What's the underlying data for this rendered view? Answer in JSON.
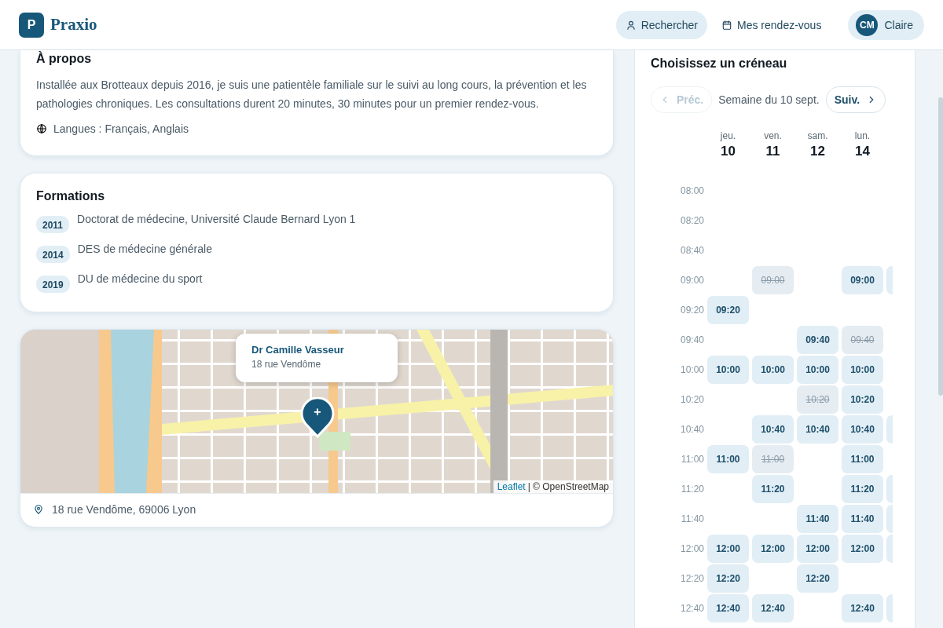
{
  "header": {
    "logo_letter": "P",
    "brand": "Praxio",
    "nav": [
      {
        "label": "Rechercher",
        "selected": true
      },
      {
        "label": "Mes rendez-vous",
        "selected": false
      }
    ],
    "user": {
      "initials": "CM",
      "name": "Claire"
    }
  },
  "about": {
    "title": "À propos",
    "text": "Installée aux Brotteaux depuis 2016, je suis une patientèle familiale sur le suivi au long cours, la prévention et les pathologies chroniques. Les consultations durent 20 minutes, 30 minutes pour un premier rendez-vous.",
    "languages": "Langues : Français, Anglais"
  },
  "education": {
    "title": "Formations",
    "items": [
      {
        "year": "2011",
        "label": "Doctorat de médecine, Université Claude Bernard Lyon 1"
      },
      {
        "year": "2014",
        "label": "DES de médecine générale"
      },
      {
        "year": "2019",
        "label": "DU de médecine du sport"
      }
    ]
  },
  "map": {
    "popup_title": "Dr Camille Vasseur",
    "popup_subtitle": "18 rue Vendôme",
    "marker_symbol": "+",
    "attribution_link": "Leaflet",
    "attribution_text": "| © OpenStreetMap",
    "address": "18 rue Vendôme, 69006 Lyon"
  },
  "calendar": {
    "title": "Choisissez un créneau",
    "prev": {
      "label": "Préc.",
      "disabled": true
    },
    "week_label": "Semaine du 10 sept.",
    "next": {
      "label": "Suiv.",
      "disabled": false
    },
    "days": [
      {
        "weekday": "jeu.",
        "day": "10"
      },
      {
        "weekday": "ven.",
        "day": "11"
      },
      {
        "weekday": "sam.",
        "day": "12"
      },
      {
        "weekday": "lun.",
        "day": "14"
      }
    ],
    "rows": [
      {
        "time": "08:00",
        "slots": [
          {
            "kind": "none"
          },
          {
            "kind": "none"
          },
          {
            "kind": "none"
          },
          {
            "kind": "none"
          }
        ]
      },
      {
        "time": "08:20",
        "slots": [
          {
            "kind": "none"
          },
          {
            "kind": "none"
          },
          {
            "kind": "none"
          },
          {
            "kind": "none"
          }
        ]
      },
      {
        "time": "08:40",
        "slots": [
          {
            "kind": "none"
          },
          {
            "kind": "none"
          },
          {
            "kind": "none"
          },
          {
            "kind": "none"
          }
        ]
      },
      {
        "time": "09:00",
        "edge_slot": true,
        "slots": [
          {
            "kind": "none"
          },
          {
            "kind": "taken",
            "label": "09:00"
          },
          {
            "kind": "none"
          },
          {
            "kind": "open",
            "label": "09:00"
          }
        ]
      },
      {
        "time": "09:20",
        "slots": [
          {
            "kind": "open",
            "label": "09:20"
          },
          {
            "kind": "none"
          },
          {
            "kind": "none"
          },
          {
            "kind": "none"
          }
        ]
      },
      {
        "time": "09:40",
        "slots": [
          {
            "kind": "none"
          },
          {
            "kind": "none"
          },
          {
            "kind": "open",
            "label": "09:40"
          },
          {
            "kind": "taken",
            "label": "09:40"
          }
        ]
      },
      {
        "time": "10:00",
        "slots": [
          {
            "kind": "open",
            "label": "10:00"
          },
          {
            "kind": "open",
            "label": "10:00"
          },
          {
            "kind": "open",
            "label": "10:00"
          },
          {
            "kind": "open",
            "label": "10:00"
          }
        ]
      },
      {
        "time": "10:20",
        "slots": [
          {
            "kind": "none"
          },
          {
            "kind": "none"
          },
          {
            "kind": "taken",
            "label": "10:20"
          },
          {
            "kind": "open",
            "label": "10:20"
          }
        ]
      },
      {
        "time": "10:40",
        "edge_slot": true,
        "slots": [
          {
            "kind": "none"
          },
          {
            "kind": "open",
            "label": "10:40"
          },
          {
            "kind": "open",
            "label": "10:40"
          },
          {
            "kind": "open",
            "label": "10:40"
          }
        ]
      },
      {
        "time": "11:00",
        "slots": [
          {
            "kind": "open",
            "label": "11:00"
          },
          {
            "kind": "taken",
            "label": "11:00"
          },
          {
            "kind": "none"
          },
          {
            "kind": "open",
            "label": "11:00"
          }
        ]
      },
      {
        "time": "11:20",
        "edge_slot": true,
        "slots": [
          {
            "kind": "none"
          },
          {
            "kind": "open",
            "label": "11:20"
          },
          {
            "kind": "none"
          },
          {
            "kind": "open",
            "label": "11:20"
          }
        ]
      },
      {
        "time": "11:40",
        "edge_slot": true,
        "slots": [
          {
            "kind": "none"
          },
          {
            "kind": "none"
          },
          {
            "kind": "open",
            "label": "11:40"
          },
          {
            "kind": "open",
            "label": "11:40"
          }
        ]
      },
      {
        "time": "12:00",
        "edge_slot": true,
        "slots": [
          {
            "kind": "open",
            "label": "12:00"
          },
          {
            "kind": "open",
            "label": "12:00"
          },
          {
            "kind": "open",
            "label": "12:00"
          },
          {
            "kind": "open",
            "label": "12:00"
          }
        ]
      },
      {
        "time": "12:20",
        "slots": [
          {
            "kind": "open",
            "label": "12:20"
          },
          {
            "kind": "none"
          },
          {
            "kind": "open",
            "label": "12:20"
          },
          {
            "kind": "none"
          }
        ]
      },
      {
        "time": "12:40",
        "edge_slot": true,
        "slots": [
          {
            "kind": "open",
            "label": "12:40"
          },
          {
            "kind": "open",
            "label": "12:40"
          },
          {
            "kind": "none"
          },
          {
            "kind": "open",
            "label": "12:40"
          }
        ]
      }
    ]
  }
}
